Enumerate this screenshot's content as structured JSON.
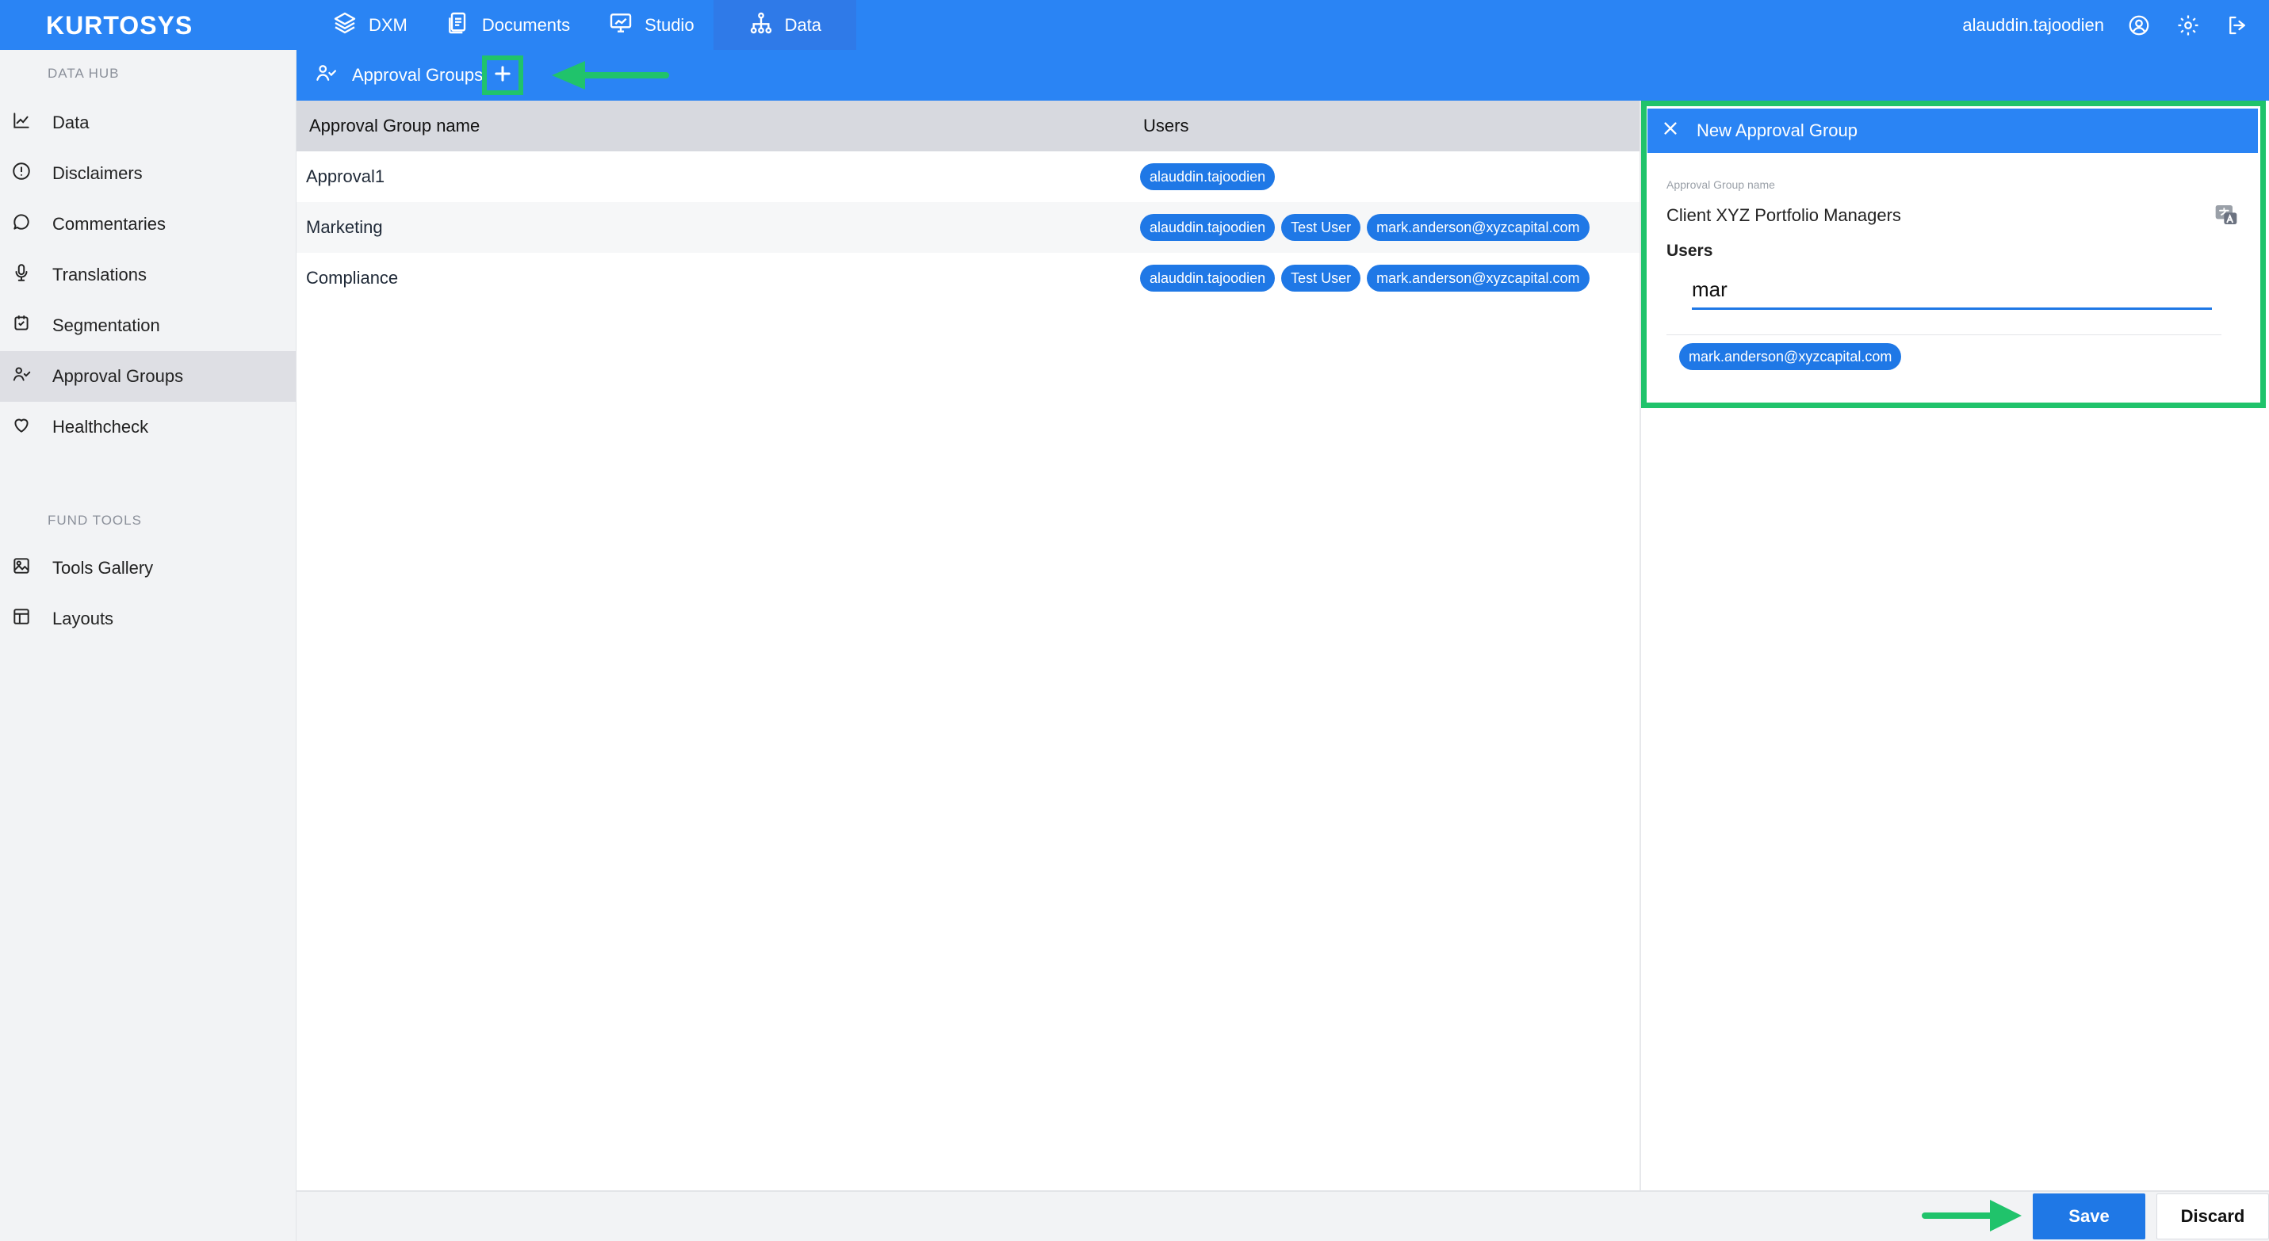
{
  "app": {
    "logo": "KURTOSYS",
    "nav": [
      {
        "label": "DXM",
        "icon": "layers-icon"
      },
      {
        "label": "Documents",
        "icon": "documents-icon"
      },
      {
        "label": "Studio",
        "icon": "studio-icon"
      },
      {
        "label": "Data",
        "icon": "data-hierarchy-icon",
        "active": true
      }
    ],
    "user": {
      "name": "alauddin.tajoodien"
    }
  },
  "sidebar": {
    "sections": [
      {
        "title": "DATA HUB",
        "items": [
          {
            "label": "Data",
            "icon": "line-chart-icon"
          },
          {
            "label": "Disclaimers",
            "icon": "info-circle-icon"
          },
          {
            "label": "Commentaries",
            "icon": "comment-icon"
          },
          {
            "label": "Translations",
            "icon": "microphone-icon"
          },
          {
            "label": "Segmentation",
            "icon": "segmentation-icon"
          },
          {
            "label": "Approval Groups",
            "icon": "user-check-icon",
            "active": true
          },
          {
            "label": "Healthcheck",
            "icon": "heart-icon"
          }
        ]
      },
      {
        "title": "FUND TOOLS",
        "items": [
          {
            "label": "Tools Gallery",
            "icon": "image-gallery-icon"
          },
          {
            "label": "Layouts",
            "icon": "layout-icon"
          }
        ]
      }
    ]
  },
  "subheader": {
    "title": "Approval Groups",
    "add_icon": "plus-icon"
  },
  "table": {
    "headers": {
      "name": "Approval Group name",
      "users": "Users"
    },
    "rows": [
      {
        "name": "Approval1",
        "users": [
          "alauddin.tajoodien"
        ]
      },
      {
        "name": "Marketing",
        "users": [
          "alauddin.tajoodien",
          "Test User",
          "mark.anderson@xyzcapital.com"
        ]
      },
      {
        "name": "Compliance",
        "users": [
          "alauddin.tajoodien",
          "Test User",
          "mark.anderson@xyzcapital.com"
        ]
      }
    ]
  },
  "panel": {
    "title": "New Approval Group",
    "group_name_label": "Approval Group name",
    "group_name_value": "Client XYZ Portfolio Managers",
    "users_label": "Users",
    "users_search_value": "mar",
    "suggestions": [
      "mark.anderson@xyzcapital.com"
    ]
  },
  "footer": {
    "save_label": "Save",
    "discard_label": "Discard"
  },
  "colors": {
    "primary": "#2a84f4",
    "highlight": "#20c36b"
  }
}
